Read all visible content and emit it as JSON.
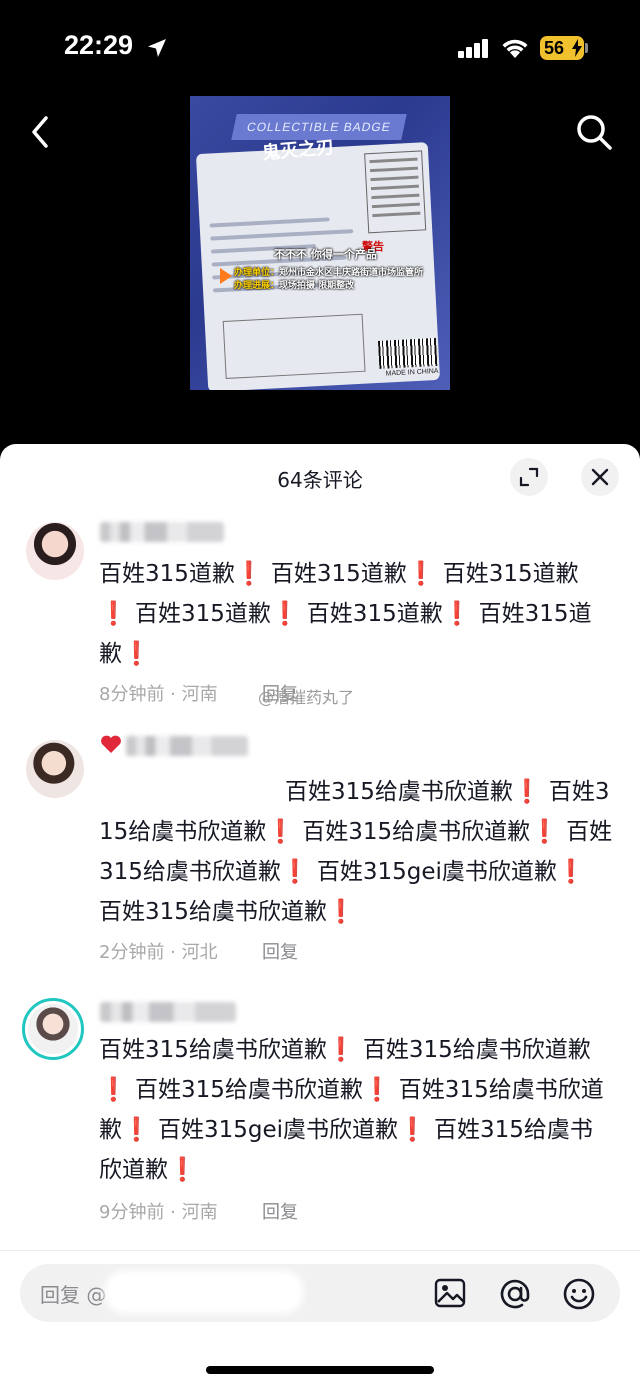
{
  "status_bar": {
    "time": "22:29",
    "battery": "56",
    "location_icon": "location-arrow-icon",
    "signal_icon": "cellular-signal-icon",
    "wifi_icon": "wifi-icon"
  },
  "nav": {
    "back_icon": "chevron-left-icon",
    "search_icon": "search-icon"
  },
  "video": {
    "badge_title": "COLLECTIBLE BADGE",
    "logo_text": "鬼灭之刃",
    "caption_top": "不不不 你得一个产品",
    "caption_line1_label": "办理单位：",
    "caption_line1_value": "郑州市金水区丰庆路街道市场监管所",
    "caption_line2_label": "办理进展：",
    "caption_line2_value": "现场拍摄 限期整改",
    "warning_title": "警告",
    "made_in": "MADE IN CHINA"
  },
  "sheet": {
    "title": "64条评论",
    "expand_icon": "expand-icon",
    "close_icon": "close-icon"
  },
  "colors": {
    "accent_red": "#e01b24",
    "meta_gray": "#a8a8ab",
    "avatar_ring": "#20c7c0"
  },
  "comments": [
    {
      "segments": [
        "百姓315道歉",
        "❗",
        " 百姓315道歉",
        "❗",
        " 百姓315道歉",
        "❗",
        " 百姓315道歉",
        "❗",
        " 百姓315道歉",
        "❗",
        " 百姓315道歉",
        "❗"
      ],
      "time": "8分钟前",
      "location": "河南",
      "reply": "回复",
      "watermark": "@漕摧药丸了"
    },
    {
      "segments": [
        "百姓315给虞书欣道歉",
        "❗",
        " 百姓315给虞书欣道歉",
        "❗",
        " 百姓315给虞书欣道歉",
        "❗",
        " 百姓315给虞书欣道歉",
        "❗",
        " 百姓315gei虞书欣道歉",
        "❗",
        " 百姓315给虞书欣道歉",
        "❗"
      ],
      "time": "2分钟前",
      "location": "河北",
      "reply": "回复"
    },
    {
      "segments": [
        "百姓315给虞书欣道歉",
        "❗",
        " 百姓315给虞书欣道歉",
        "❗",
        " 百姓315给虞书欣道歉",
        "❗",
        " 百姓315给虞书欣道歉",
        "❗",
        " 百姓315gei虞书欣道歉",
        "❗",
        " 百姓315给虞书欣道歉",
        "❗"
      ],
      "time": "9分钟前",
      "location": "河南",
      "reply": "回复"
    }
  ],
  "input_bar": {
    "placeholder": "回复 @",
    "image_icon": "image-icon",
    "at_icon": "at-mention-icon",
    "emoji_icon": "emoji-icon"
  }
}
